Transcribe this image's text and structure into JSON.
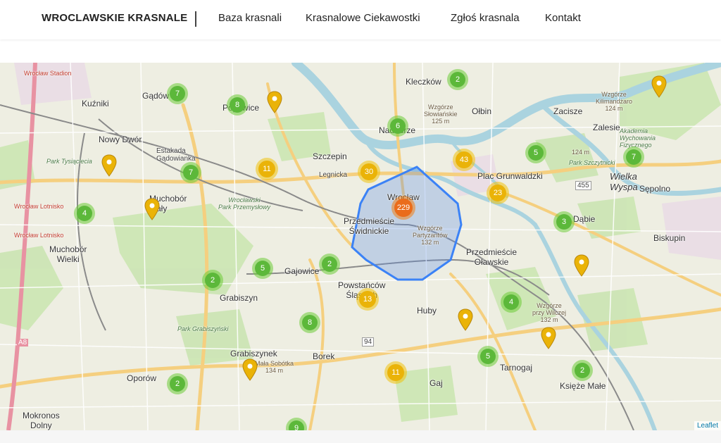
{
  "header": {
    "brand": "WROCLAWSKIE KRASNALE",
    "nav": [
      "Baza krasnali",
      "Krasnalowe Ciekawostki",
      "Zgłoś krasnala",
      "Kontakt"
    ]
  },
  "map": {
    "attribution": "Leaflet",
    "colors": {
      "park": "#c8e6b0",
      "water": "#aad3df",
      "urban": "#ececdf",
      "road_major": "#f7d58b",
      "road_minor": "#ffffff",
      "rail": "#8a8a8a",
      "polygon": "#3b82f6",
      "highway": "#e892a2"
    },
    "labels": {
      "wroclaw_stadion": "Wrocław Stadion",
      "gadow": "Gądów",
      "kuzniki": "Kuźniki",
      "popowice": "Popowice",
      "kleczkow": "Kleczków",
      "nadodrze": "Nadodrze",
      "olbin": "Ołbin",
      "zacisze": "Zacisze",
      "zalesie": "Zalesie",
      "nowy_dwor": "Nowy Dwór",
      "estakada": "Estakada\nGądowianka",
      "szczepin": "Szczepin",
      "plac_grunwaldzki": "Plac Grunwaldzki",
      "wielka_wyspa": "Wielka\nWyspa",
      "sepolno": "Sępolno",
      "park_tysiaclecia": "Park Tysiąclecia",
      "legnicka": "Legnicka",
      "muchobor_maly": "Muchobór\nMały",
      "park_przemyslowy": "Wrocławski\nPark Przemysłowy",
      "wroclaw": "Wrocław",
      "wroclaw_lotnisko": "Wrocław Lotnisko",
      "wroclaw_lotnisko2": "Wrocław Lotnisko",
      "przedmiescie_swidnickie": "Przedmieście\nŚwidnickie",
      "wzgorze_partyzantow": "Wzgórze\nPartyzantów\n132 m",
      "dabie": "Dąbie",
      "biskupin": "Biskupin",
      "muchobor_wielki": "Muchobór\nWielki",
      "gajowice": "Gajowice",
      "przedmiescie_olawskie": "Przedmieście\nOławskie",
      "powstancow": "Powstańców\nŚląskich",
      "grabiszyn": "Grabiszyn",
      "park_grabiszynski": "Park Grabiszyński",
      "huby": "Huby",
      "wzgorze_wilczej": "Wzgórze\nprzy Wilczej\n132 m",
      "grabiszynek": "Grabiszynek",
      "gora_sobotka": "Mała Sobótka\n134 m",
      "borek": "Borek",
      "tarnogaj": "Tarnogaj",
      "oporow": "Oporów",
      "gaj": "Gaj",
      "ksieze_male": "Księże Małe",
      "mokronos": "Mokronos\nDolny",
      "wzgorze_slowianskie": "Wzgórze\nSłowiańskie\n125 m",
      "wzgorze_kilimandzaro": "Wzgórze\nKilimandżaro\n124 m",
      "akademia": "Akademia\nWychowania\nFizycznego",
      "park_szczytnicki": "Park Szczytnicki",
      "h124": "124 m",
      "a8": "A8",
      "r94": "94",
      "r455": "455"
    },
    "clusters": [
      {
        "count": "7",
        "size": "small"
      },
      {
        "count": "8",
        "size": "small"
      },
      {
        "count": "2",
        "size": "small"
      },
      {
        "count": "6",
        "size": "small"
      },
      {
        "count": "7",
        "size": "small"
      },
      {
        "count": "11",
        "size": "medium"
      },
      {
        "count": "30",
        "size": "medium"
      },
      {
        "count": "43",
        "size": "medium"
      },
      {
        "count": "5",
        "size": "small"
      },
      {
        "count": "7",
        "size": "small"
      },
      {
        "count": "23",
        "size": "medium"
      },
      {
        "count": "229",
        "size": "large"
      },
      {
        "count": "4",
        "size": "small"
      },
      {
        "count": "3",
        "size": "small"
      },
      {
        "count": "5",
        "size": "small"
      },
      {
        "count": "2",
        "size": "small"
      },
      {
        "count": "2",
        "size": "small"
      },
      {
        "count": "13",
        "size": "medium"
      },
      {
        "count": "4",
        "size": "small"
      },
      {
        "count": "8",
        "size": "small"
      },
      {
        "count": "5",
        "size": "small"
      },
      {
        "count": "11",
        "size": "medium"
      },
      {
        "count": "2",
        "size": "small"
      },
      {
        "count": "2",
        "size": "small"
      },
      {
        "count": "9",
        "size": "small"
      }
    ],
    "pins": 8
  }
}
